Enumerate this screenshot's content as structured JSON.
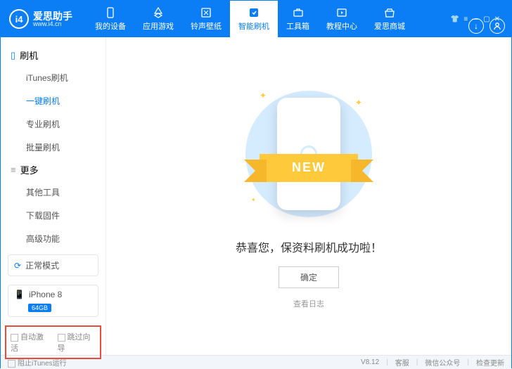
{
  "brand": {
    "name": "爱思助手",
    "url": "www.i4.cn",
    "logo_letter": "i4"
  },
  "tabs": [
    {
      "label": "我的设备",
      "icon": "device"
    },
    {
      "label": "应用游戏",
      "icon": "apps"
    },
    {
      "label": "铃声壁纸",
      "icon": "ringtone"
    },
    {
      "label": "智能刷机",
      "icon": "flash",
      "active": true
    },
    {
      "label": "工具箱",
      "icon": "toolbox"
    },
    {
      "label": "教程中心",
      "icon": "tutorial"
    },
    {
      "label": "爱思商城",
      "icon": "store"
    }
  ],
  "sidebar": {
    "sections": [
      {
        "title": "刷机",
        "icon": "phone",
        "items": [
          {
            "label": "iTunes刷机"
          },
          {
            "label": "一键刷机",
            "active": true
          },
          {
            "label": "专业刷机"
          },
          {
            "label": "批量刷机"
          }
        ]
      },
      {
        "title": "更多",
        "icon": "more",
        "items": [
          {
            "label": "其他工具"
          },
          {
            "label": "下载固件"
          },
          {
            "label": "高级功能"
          }
        ]
      }
    ],
    "mode": {
      "label": "正常模式"
    },
    "device": {
      "name": "iPhone 8",
      "storage": "64GB"
    },
    "bottom": [
      {
        "label": "自动激活"
      },
      {
        "label": "跳过向导"
      }
    ]
  },
  "main": {
    "ribbon": "NEW",
    "message": "恭喜您，保资料刷机成功啦！",
    "ok": "确定",
    "log": "查看日志"
  },
  "footer": {
    "block_itunes": "阻止iTunes运行",
    "version": "V8.12",
    "links": [
      "客服",
      "微信公众号",
      "检查更新"
    ]
  }
}
